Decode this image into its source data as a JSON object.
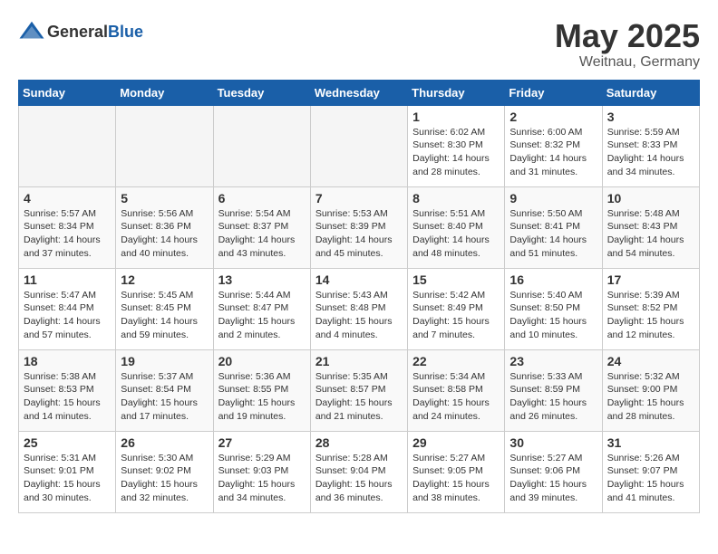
{
  "header": {
    "logo_general": "General",
    "logo_blue": "Blue",
    "month": "May 2025",
    "location": "Weitnau, Germany"
  },
  "weekdays": [
    "Sunday",
    "Monday",
    "Tuesday",
    "Wednesday",
    "Thursday",
    "Friday",
    "Saturday"
  ],
  "weeks": [
    [
      {
        "day": "",
        "empty": true
      },
      {
        "day": "",
        "empty": true
      },
      {
        "day": "",
        "empty": true
      },
      {
        "day": "",
        "empty": true
      },
      {
        "day": "1",
        "sunrise": "6:02 AM",
        "sunset": "8:30 PM",
        "daylight": "14 hours and 28 minutes."
      },
      {
        "day": "2",
        "sunrise": "6:00 AM",
        "sunset": "8:32 PM",
        "daylight": "14 hours and 31 minutes."
      },
      {
        "day": "3",
        "sunrise": "5:59 AM",
        "sunset": "8:33 PM",
        "daylight": "14 hours and 34 minutes."
      }
    ],
    [
      {
        "day": "4",
        "sunrise": "5:57 AM",
        "sunset": "8:34 PM",
        "daylight": "14 hours and 37 minutes."
      },
      {
        "day": "5",
        "sunrise": "5:56 AM",
        "sunset": "8:36 PM",
        "daylight": "14 hours and 40 minutes."
      },
      {
        "day": "6",
        "sunrise": "5:54 AM",
        "sunset": "8:37 PM",
        "daylight": "14 hours and 43 minutes."
      },
      {
        "day": "7",
        "sunrise": "5:53 AM",
        "sunset": "8:39 PM",
        "daylight": "14 hours and 45 minutes."
      },
      {
        "day": "8",
        "sunrise": "5:51 AM",
        "sunset": "8:40 PM",
        "daylight": "14 hours and 48 minutes."
      },
      {
        "day": "9",
        "sunrise": "5:50 AM",
        "sunset": "8:41 PM",
        "daylight": "14 hours and 51 minutes."
      },
      {
        "day": "10",
        "sunrise": "5:48 AM",
        "sunset": "8:43 PM",
        "daylight": "14 hours and 54 minutes."
      }
    ],
    [
      {
        "day": "11",
        "sunrise": "5:47 AM",
        "sunset": "8:44 PM",
        "daylight": "14 hours and 57 minutes."
      },
      {
        "day": "12",
        "sunrise": "5:45 AM",
        "sunset": "8:45 PM",
        "daylight": "14 hours and 59 minutes."
      },
      {
        "day": "13",
        "sunrise": "5:44 AM",
        "sunset": "8:47 PM",
        "daylight": "15 hours and 2 minutes."
      },
      {
        "day": "14",
        "sunrise": "5:43 AM",
        "sunset": "8:48 PM",
        "daylight": "15 hours and 4 minutes."
      },
      {
        "day": "15",
        "sunrise": "5:42 AM",
        "sunset": "8:49 PM",
        "daylight": "15 hours and 7 minutes."
      },
      {
        "day": "16",
        "sunrise": "5:40 AM",
        "sunset": "8:50 PM",
        "daylight": "15 hours and 10 minutes."
      },
      {
        "day": "17",
        "sunrise": "5:39 AM",
        "sunset": "8:52 PM",
        "daylight": "15 hours and 12 minutes."
      }
    ],
    [
      {
        "day": "18",
        "sunrise": "5:38 AM",
        "sunset": "8:53 PM",
        "daylight": "15 hours and 14 minutes."
      },
      {
        "day": "19",
        "sunrise": "5:37 AM",
        "sunset": "8:54 PM",
        "daylight": "15 hours and 17 minutes."
      },
      {
        "day": "20",
        "sunrise": "5:36 AM",
        "sunset": "8:55 PM",
        "daylight": "15 hours and 19 minutes."
      },
      {
        "day": "21",
        "sunrise": "5:35 AM",
        "sunset": "8:57 PM",
        "daylight": "15 hours and 21 minutes."
      },
      {
        "day": "22",
        "sunrise": "5:34 AM",
        "sunset": "8:58 PM",
        "daylight": "15 hours and 24 minutes."
      },
      {
        "day": "23",
        "sunrise": "5:33 AM",
        "sunset": "8:59 PM",
        "daylight": "15 hours and 26 minutes."
      },
      {
        "day": "24",
        "sunrise": "5:32 AM",
        "sunset": "9:00 PM",
        "daylight": "15 hours and 28 minutes."
      }
    ],
    [
      {
        "day": "25",
        "sunrise": "5:31 AM",
        "sunset": "9:01 PM",
        "daylight": "15 hours and 30 minutes."
      },
      {
        "day": "26",
        "sunrise": "5:30 AM",
        "sunset": "9:02 PM",
        "daylight": "15 hours and 32 minutes."
      },
      {
        "day": "27",
        "sunrise": "5:29 AM",
        "sunset": "9:03 PM",
        "daylight": "15 hours and 34 minutes."
      },
      {
        "day": "28",
        "sunrise": "5:28 AM",
        "sunset": "9:04 PM",
        "daylight": "15 hours and 36 minutes."
      },
      {
        "day": "29",
        "sunrise": "5:27 AM",
        "sunset": "9:05 PM",
        "daylight": "15 hours and 38 minutes."
      },
      {
        "day": "30",
        "sunrise": "5:27 AM",
        "sunset": "9:06 PM",
        "daylight": "15 hours and 39 minutes."
      },
      {
        "day": "31",
        "sunrise": "5:26 AM",
        "sunset": "9:07 PM",
        "daylight": "15 hours and 41 minutes."
      }
    ]
  ]
}
